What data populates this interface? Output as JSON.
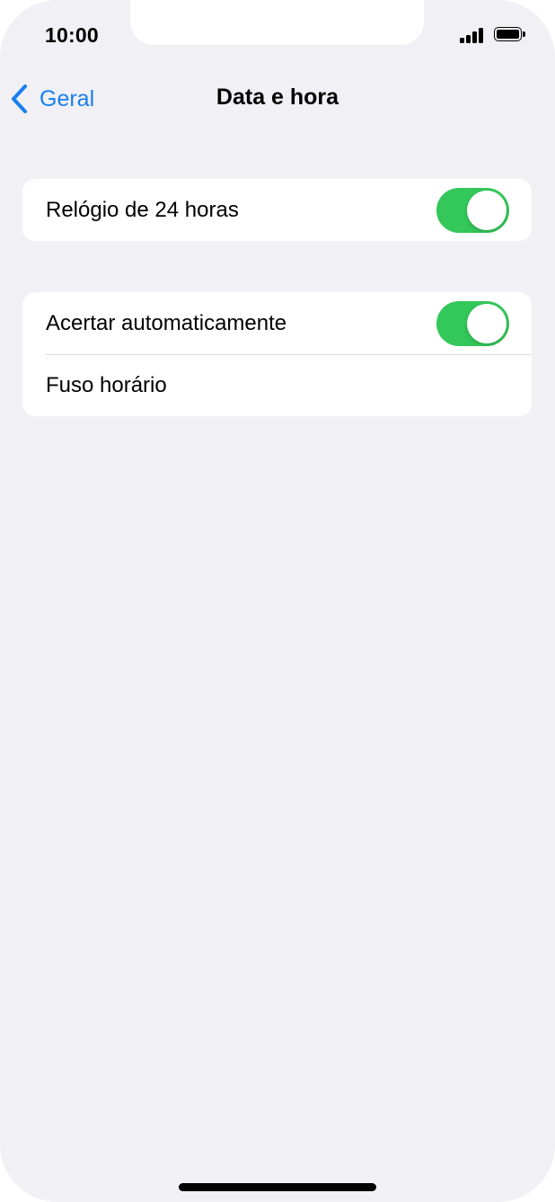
{
  "status_bar": {
    "time": "10:00",
    "signal_icon": "cellular-signal-icon",
    "battery_icon": "battery-icon"
  },
  "nav": {
    "back_label": "Geral",
    "back_icon": "chevron-left-icon",
    "title": "Data e hora"
  },
  "groups": [
    {
      "rows": [
        {
          "label": "Relógio de 24 horas",
          "toggle_on": true
        }
      ]
    },
    {
      "rows": [
        {
          "label": "Acertar automaticamente",
          "toggle_on": true
        },
        {
          "label": "Fuso horário"
        }
      ]
    }
  ],
  "colors": {
    "accent": "#1a7ff0",
    "toggle_on": "#34c759",
    "background": "#f0f0f5"
  }
}
